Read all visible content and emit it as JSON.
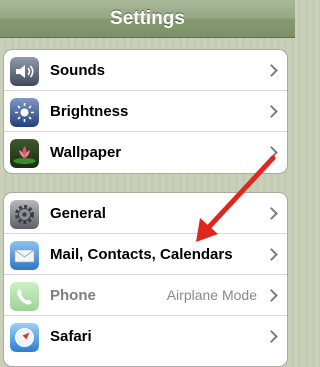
{
  "navbar": {
    "title": "Settings"
  },
  "group1": {
    "items": [
      {
        "label": "Sounds",
        "icon": "sounds-icon"
      },
      {
        "label": "Brightness",
        "icon": "brightness-icon"
      },
      {
        "label": "Wallpaper",
        "icon": "wallpaper-icon"
      }
    ]
  },
  "group2": {
    "items": [
      {
        "label": "General",
        "icon": "general-gear-icon"
      },
      {
        "label": "Mail, Contacts, Calendars",
        "icon": "mail-icon"
      },
      {
        "label": "Phone",
        "icon": "phone-icon",
        "detail": "Airplane Mode",
        "disabled": true
      },
      {
        "label": "Safari",
        "icon": "safari-icon"
      }
    ]
  },
  "colors": {
    "navbar": "#8a9d74",
    "background_stripes": "#c9d1bb",
    "annotation_arrow": "#e0271f"
  }
}
